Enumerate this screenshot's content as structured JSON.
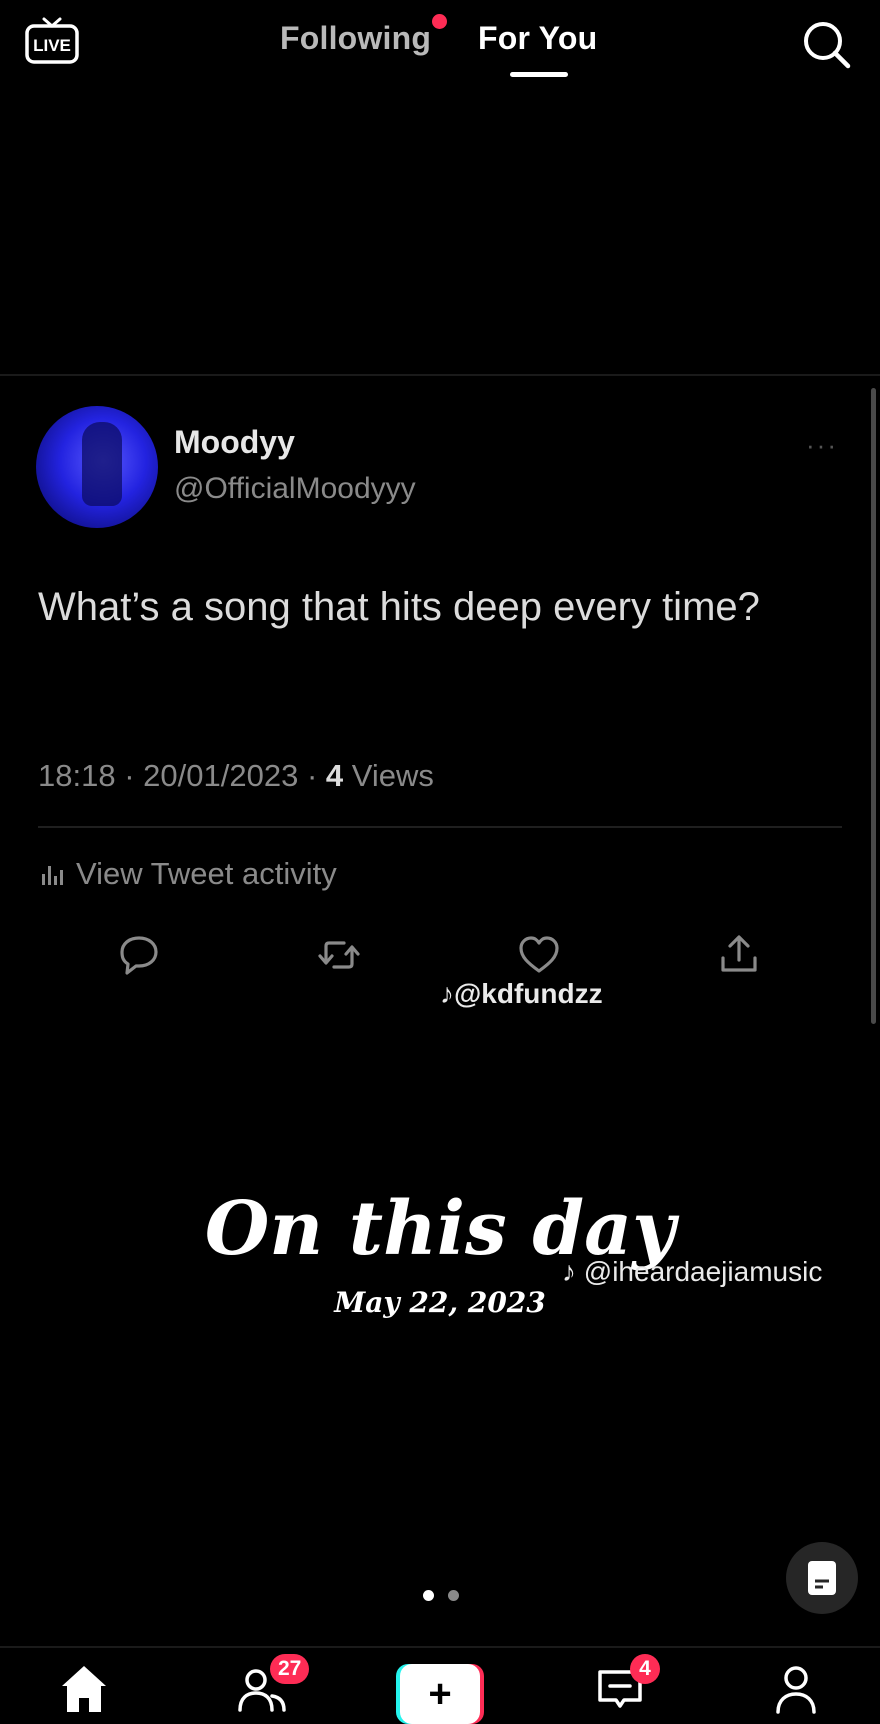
{
  "top_bar": {
    "live_label": "LIVE",
    "tabs": [
      {
        "label": "Following",
        "active": false,
        "has_notification_dot": true
      },
      {
        "label": "For You",
        "active": true
      }
    ]
  },
  "tweet": {
    "display_name": "Moodyy",
    "handle": "@OfficialMoodyyy",
    "more_label": "···",
    "text": "What’s a song that hits deep every time?",
    "time": "18:18",
    "date": "20/01/2023",
    "views_count": "4",
    "views_label": "Views",
    "separator": "·",
    "activity_label": "View Tweet activity"
  },
  "watermarks": {
    "first": "@kdfundzz",
    "second": "@iheardaejiamusic"
  },
  "memory": {
    "title": "On this day",
    "date": "May 22, 2023"
  },
  "bottom_nav": {
    "friends_badge": "27",
    "inbox_badge": "4",
    "create_symbol": "+"
  },
  "colors": {
    "accent": "#fe2c55",
    "cyan": "#25f4ee",
    "background": "#000000"
  }
}
